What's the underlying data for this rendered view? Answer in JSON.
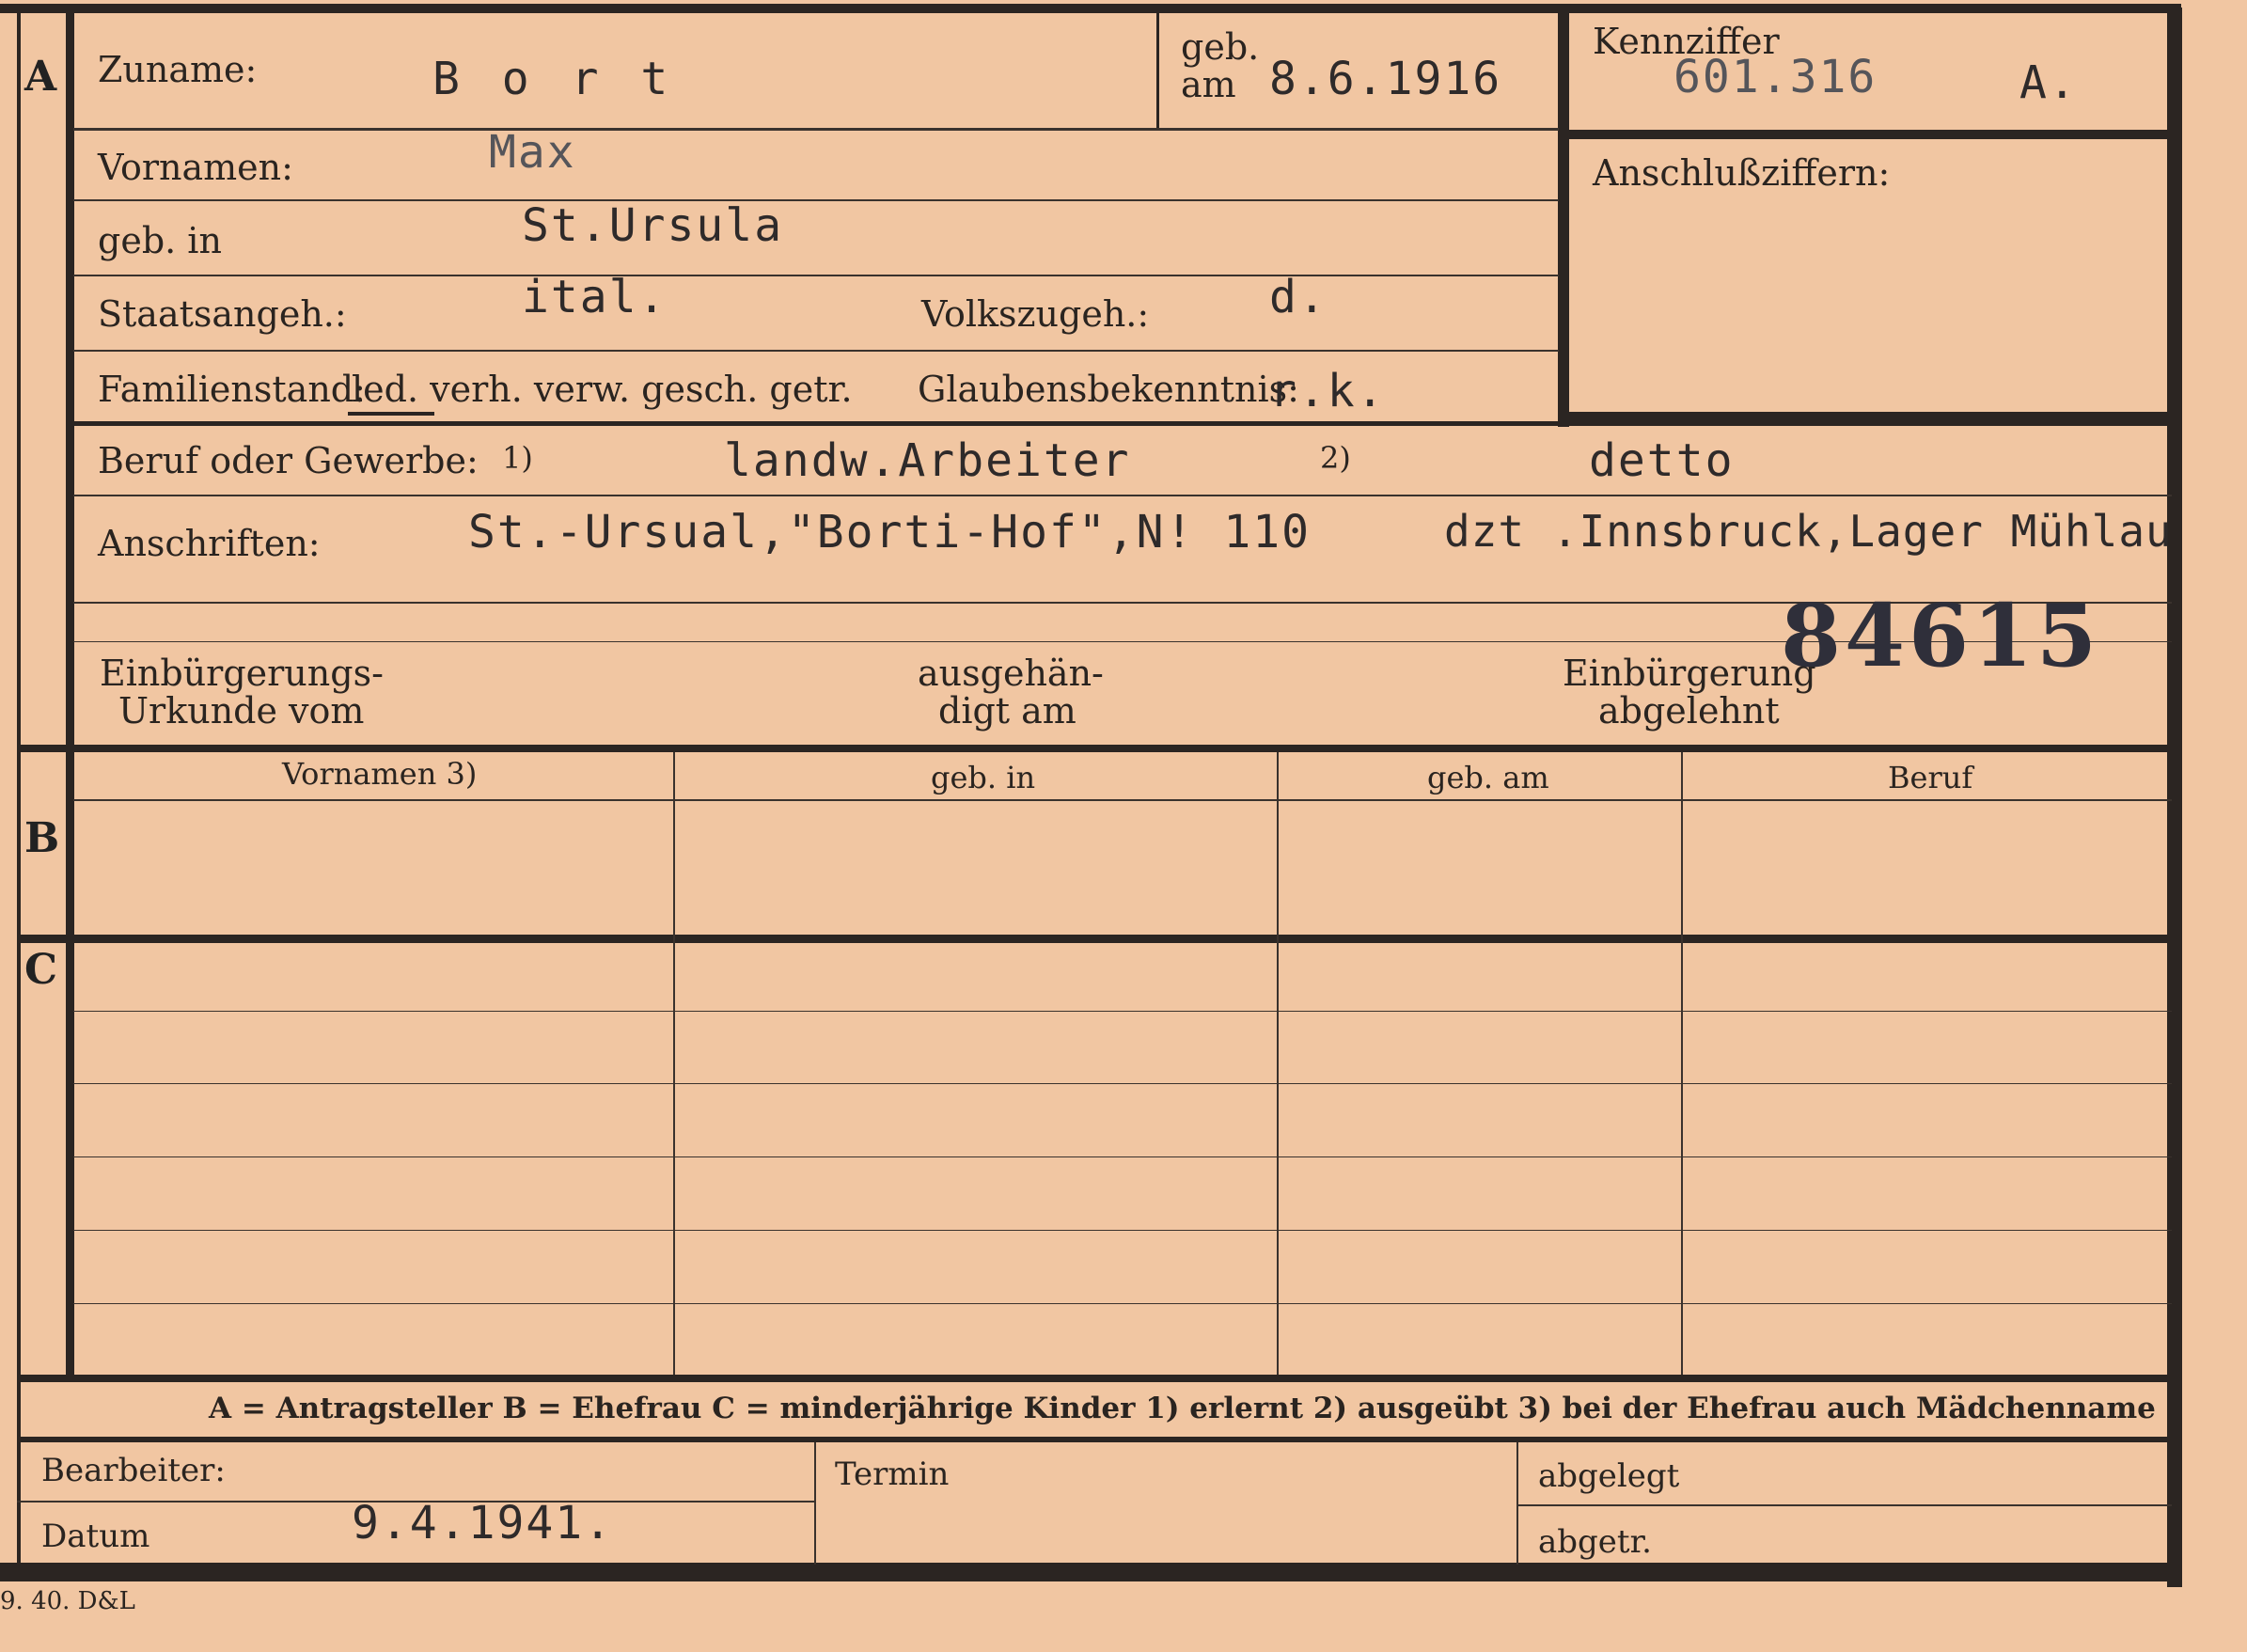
{
  "sections": {
    "a": "A",
    "b": "B",
    "c": "C"
  },
  "header": {
    "zuname_label": "Zuname:",
    "zuname_value": "B o r t",
    "geb_label_1": "geb.",
    "geb_label_2": "am",
    "geb_value": "8.6.1916",
    "kennziffer_label": "Kennziffer",
    "kennziffer_value": "601.316",
    "kennziffer_suffix": "A.",
    "anschluss_label": "Anschlußziffern:"
  },
  "person": {
    "vornamen_label": "Vornamen:",
    "vornamen_value": "Max",
    "gebin_label": "geb. in",
    "gebin_value": "St.Ursula",
    "staat_label": "Staatsangeh.:",
    "staat_value": "ital.",
    "volk_label": "Volkszugeh.:",
    "volk_value": "d.",
    "familien_label": "Familienstand:",
    "familien_options": "led. verh. verw. gesch. getr.",
    "glauben_label": "Glaubensbekenntnis:",
    "glauben_value": "r.k.",
    "beruf_label": "Beruf oder Gewerbe:",
    "beruf_note1": "1)",
    "beruf_value": "landw.Arbeiter",
    "beruf_note2": "2)",
    "beruf_value2": "detto",
    "anschriften_label": "Anschriften:",
    "anschriften_value1": "St.-Ursual,\"Borti-Hof\",N! 110",
    "anschriften_value2": "dzt .Innsbruck,Lager Mühlau",
    "stamp_number": "84615",
    "einb_label_1": "Einbürgerungs-",
    "einb_label_2": "Urkunde vom",
    "ausgeh_label_1": "ausgehän-",
    "ausgeh_label_2": "digt am",
    "abgelehnt_label_1": "Einbürgerung",
    "abgelehnt_label_2": "abgelehnt"
  },
  "table": {
    "headers": [
      "Vornamen 3)",
      "geb. in",
      "geb. am",
      "Beruf"
    ]
  },
  "legend": "A = Antragsteller    B = Ehefrau    C = minderjährige Kinder    1) erlernt    2) ausgeübt    3) bei der Ehefrau auch Mädchenname",
  "footer": {
    "bearbeiter_label": "Bearbeiter:",
    "datum_label": "Datum",
    "datum_value": "9.4.1941.",
    "termin_label": "Termin",
    "abgelegt_label": "abgelegt",
    "abgetr_label": "abgetr.",
    "print_code": "9. 40. D&L"
  }
}
